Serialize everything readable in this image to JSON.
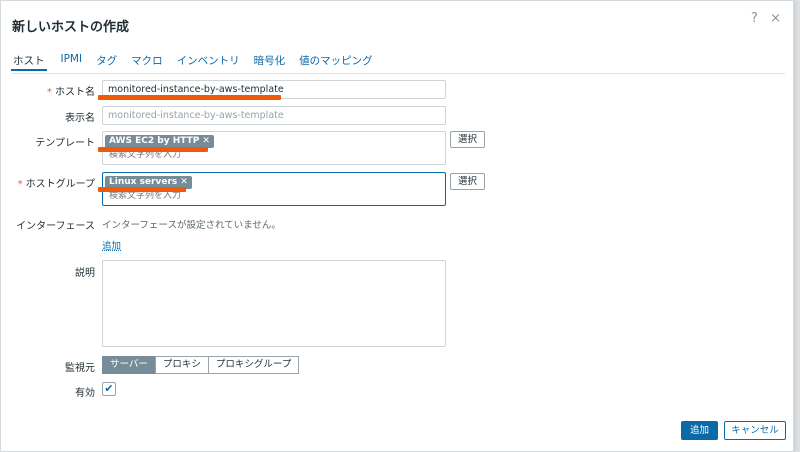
{
  "dialog": {
    "title": "新しいホストの作成",
    "help_icon": "?",
    "close_icon": "×"
  },
  "tabs": [
    {
      "label": "ホスト",
      "active": true
    },
    {
      "label": "IPMI"
    },
    {
      "label": "タグ"
    },
    {
      "label": "マクロ"
    },
    {
      "label": "インベントリ"
    },
    {
      "label": "暗号化"
    },
    {
      "label": "値のマッピング"
    }
  ],
  "form": {
    "required_mark": "*",
    "host_name": {
      "label": "ホスト名",
      "value": "monitored-instance-by-aws-template"
    },
    "visible_name": {
      "label": "表示名",
      "placeholder": "monitored-instance-by-aws-template"
    },
    "templates": {
      "label": "テンプレート",
      "chip": "AWS EC2 by HTTP",
      "search_placeholder": "検索文字列を入力",
      "select_label": "選択"
    },
    "host_groups": {
      "label": "ホストグループ",
      "chip": "Linux servers",
      "search_placeholder": "検索文字列を入力",
      "select_label": "選択"
    },
    "interfaces": {
      "label": "インターフェース",
      "empty_text": "インターフェースが設定されていません。",
      "add_link": "追加"
    },
    "description": {
      "label": "説明",
      "value": ""
    },
    "monitored_by": {
      "label": "監視元",
      "options": [
        "サーバー",
        "プロキシ",
        "プロキシグループ"
      ],
      "selected": "サーバー"
    },
    "enabled": {
      "label": "有効",
      "checked": true,
      "check_glyph": "✔"
    }
  },
  "footer": {
    "add_label": "追加",
    "cancel_label": "キャンセル"
  },
  "colors": {
    "accent": "#0a6aa8",
    "chip": "#768d99",
    "annotation_mark": "#ee5a0a",
    "required": "#e45959"
  }
}
